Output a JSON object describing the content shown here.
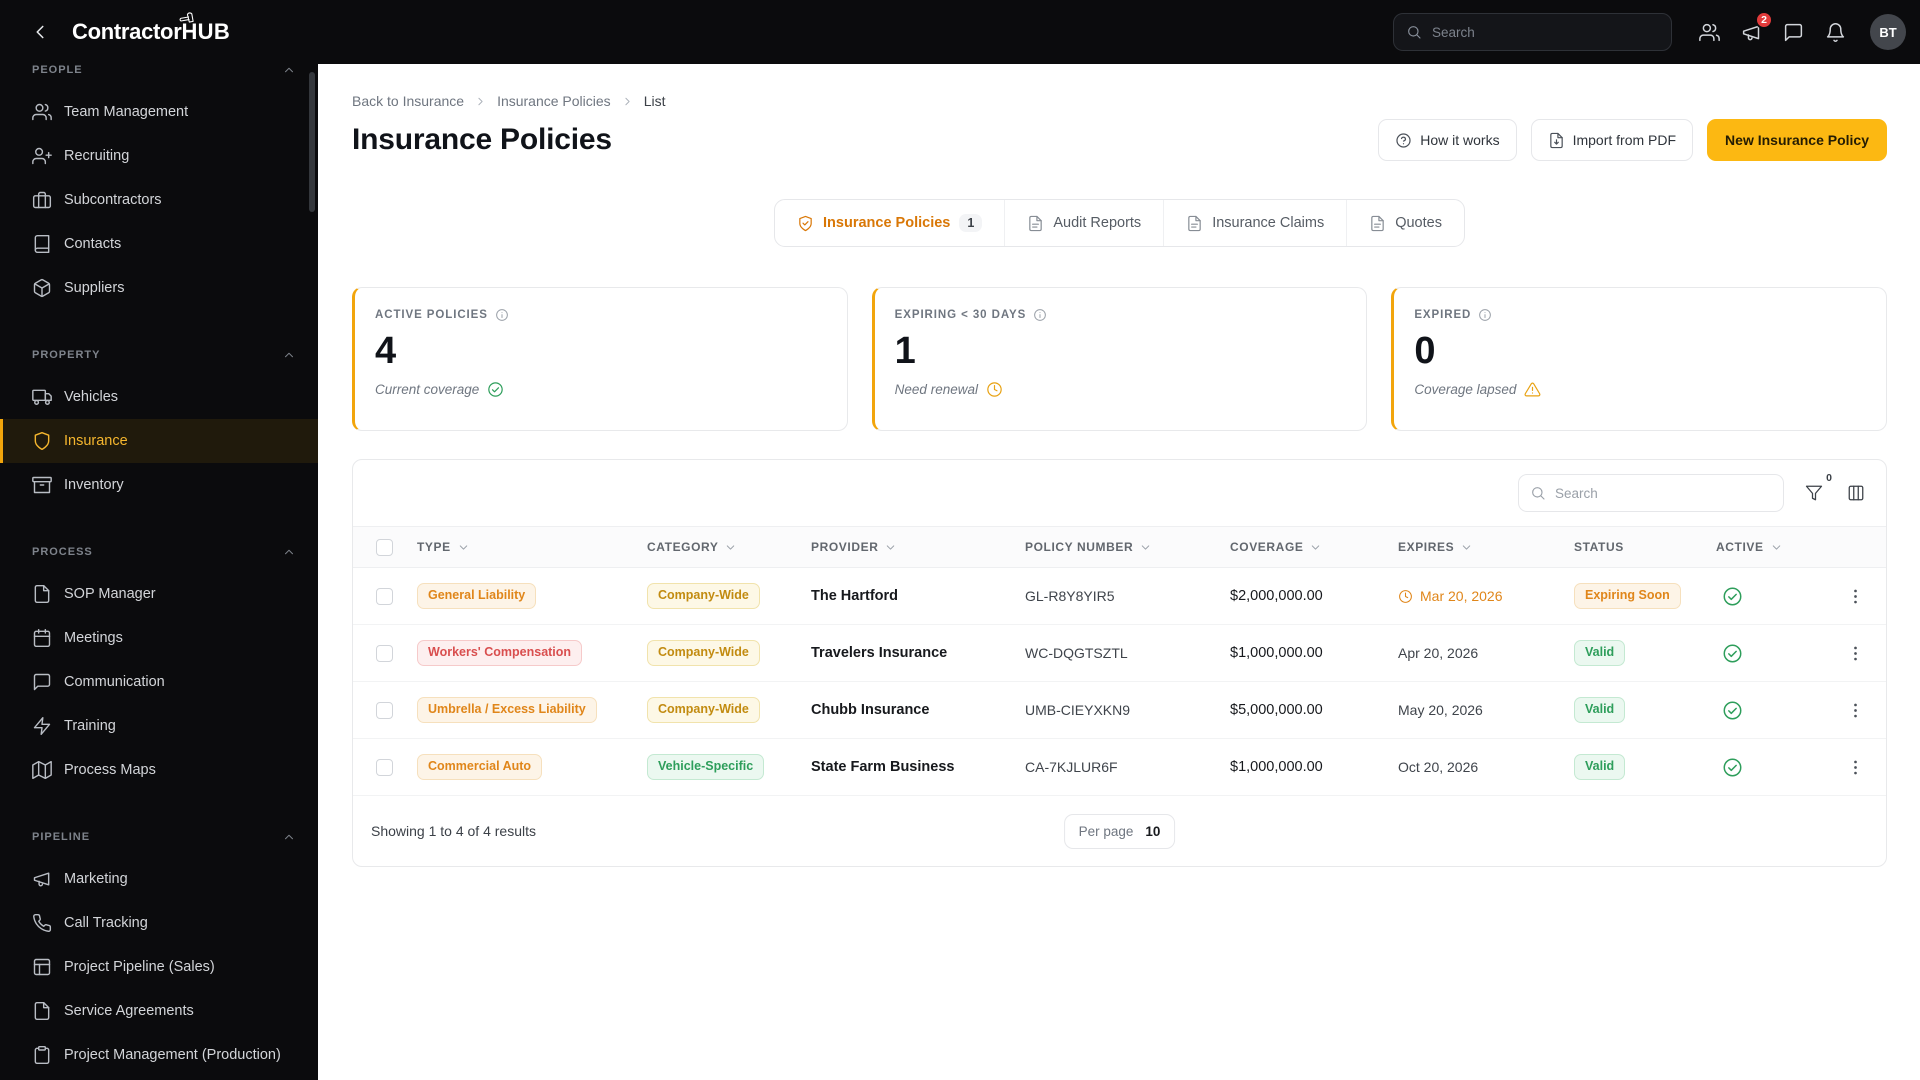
{
  "colors": {
    "topbar_bg": "#0b0b0d",
    "accent_yellow": "#fcb812",
    "sidebar_active": "#f2a50c",
    "tab_active_orange": "#d97706",
    "pill_orange": "#e0861a",
    "pill_red": "#d94f4f",
    "pill_gold": "#c28b10",
    "pill_green": "#2e9e5b",
    "notification_red": "#e23b3b"
  },
  "topbar": {
    "brand_part1": "Contractor",
    "brand_part2": "HUB",
    "search_placeholder": "Search",
    "notification_count": "2",
    "avatar_initials": "BT"
  },
  "sidebar": {
    "sections": [
      {
        "label": "PEOPLE",
        "items": [
          {
            "label": "Team Management",
            "icon": "users-icon"
          },
          {
            "label": "Recruiting",
            "icon": "user-plus-icon"
          },
          {
            "label": "Subcontractors",
            "icon": "briefcase-icon"
          },
          {
            "label": "Contacts",
            "icon": "contacts-book-icon"
          },
          {
            "label": "Suppliers",
            "icon": "package-icon"
          }
        ]
      },
      {
        "label": "PROPERTY",
        "items": [
          {
            "label": "Vehicles",
            "icon": "truck-icon"
          },
          {
            "label": "Insurance",
            "icon": "shield-icon"
          },
          {
            "label": "Inventory",
            "icon": "archive-icon"
          }
        ]
      },
      {
        "label": "PROCESS",
        "items": [
          {
            "label": "SOP Manager",
            "icon": "document-icon"
          },
          {
            "label": "Meetings",
            "icon": "calendar-icon"
          },
          {
            "label": "Communication",
            "icon": "chat-icon"
          },
          {
            "label": "Training",
            "icon": "zap-icon"
          },
          {
            "label": "Process Maps",
            "icon": "map-icon"
          }
        ]
      },
      {
        "label": "PIPELINE",
        "items": [
          {
            "label": "Marketing",
            "icon": "megaphone-icon"
          },
          {
            "label": "Call Tracking",
            "icon": "phone-icon"
          },
          {
            "label": "Project Pipeline (Sales)",
            "icon": "layout-icon"
          },
          {
            "label": "Service Agreements",
            "icon": "document-icon"
          },
          {
            "label": "Project Management (Production)",
            "icon": "clipboard-icon"
          }
        ]
      }
    ],
    "active_item": "Insurance"
  },
  "breadcrumb": {
    "items": [
      "Back to Insurance",
      "Insurance Policies",
      "List"
    ]
  },
  "page": {
    "title": "Insurance Policies",
    "how_it_works_label": "How it works",
    "import_pdf_label": "Import from PDF",
    "new_policy_label": "New Insurance Policy"
  },
  "tabs": [
    {
      "label": "Insurance Policies",
      "badge": "1",
      "active": true
    },
    {
      "label": "Audit Reports",
      "active": false
    },
    {
      "label": "Insurance Claims",
      "active": false
    },
    {
      "label": "Quotes",
      "active": false
    }
  ],
  "stats": [
    {
      "label": "ACTIVE POLICIES",
      "value": "4",
      "subtext": "Current coverage",
      "icon": "check-circle-icon"
    },
    {
      "label": "EXPIRING < 30 DAYS",
      "value": "1",
      "subtext": "Need renewal",
      "icon": "clock-icon"
    },
    {
      "label": "EXPIRED",
      "value": "0",
      "subtext": "Coverage lapsed",
      "icon": "alert-triangle-icon"
    }
  ],
  "table": {
    "search_placeholder": "Search",
    "filter_badge": "0",
    "headers": {
      "type": "TYPE",
      "category": "CATEGORY",
      "provider": "PROVIDER",
      "policy_number": "POLICY NUMBER",
      "coverage": "COVERAGE",
      "expires": "EXPIRES",
      "status": "STATUS",
      "active": "ACTIVE"
    },
    "rows": [
      {
        "type": "General Liability",
        "type_tone": "orange",
        "category": "Company-Wide",
        "category_tone": "gold",
        "provider": "The Hartford",
        "policy_number": "GL-R8Y8YIR5",
        "coverage": "$2,000,000.00",
        "expires": "Mar 20, 2026",
        "expires_warning": true,
        "status": "Expiring Soon",
        "status_tone": "orange",
        "active": true
      },
      {
        "type": "Workers' Compensation",
        "type_tone": "red",
        "category": "Company-Wide",
        "category_tone": "gold",
        "provider": "Travelers Insurance",
        "policy_number": "WC-DQGTSZTL",
        "coverage": "$1,000,000.00",
        "expires": "Apr 20, 2026",
        "expires_warning": false,
        "status": "Valid",
        "status_tone": "green",
        "active": true
      },
      {
        "type": "Umbrella / Excess Liability",
        "type_tone": "orange",
        "category": "Company-Wide",
        "category_tone": "gold",
        "provider": "Chubb Insurance",
        "policy_number": "UMB-CIEYXKN9",
        "coverage": "$5,000,000.00",
        "expires": "May 20, 2026",
        "expires_warning": false,
        "status": "Valid",
        "status_tone": "green",
        "active": true
      },
      {
        "type": "Commercial Auto",
        "type_tone": "orange",
        "category": "Vehicle-Specific",
        "category_tone": "green",
        "provider": "State Farm Business",
        "policy_number": "CA-7KJLUR6F",
        "coverage": "$1,000,000.00",
        "expires": "Oct 20, 2026",
        "expires_warning": false,
        "status": "Valid",
        "status_tone": "green",
        "active": true
      }
    ],
    "footer": {
      "showing_text": "Showing 1 to 4 of 4 results",
      "per_page_label": "Per page",
      "per_page_value": "10"
    }
  }
}
